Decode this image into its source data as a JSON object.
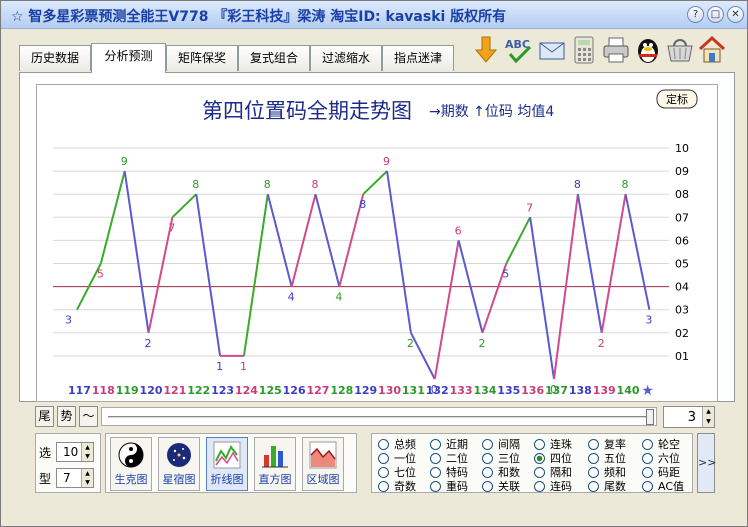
{
  "window": {
    "title": "☆ 智多星彩票预测全能王V778 『彩王科技』梁涛 淘宝ID: kavaski 版权所有"
  },
  "tabs": [
    {
      "label": "历史数据",
      "active": false
    },
    {
      "label": "分析预测",
      "active": true
    },
    {
      "label": "矩阵保奖",
      "active": false
    },
    {
      "label": "复式组合",
      "active": false
    },
    {
      "label": "过滤缩水",
      "active": false
    },
    {
      "label": "指点迷津",
      "active": false
    }
  ],
  "toolbar": {
    "icons": [
      "download-arrow-icon",
      "spellcheck-abc-icon",
      "envelope-icon",
      "calculator-icon",
      "printer-icon",
      "qq-penguin-icon",
      "shopping-basket-icon",
      "home-icon"
    ]
  },
  "chart_data": {
    "type": "line",
    "title": "第四位置码全期走势图",
    "legend_text": "→期数 ↑位码 均值4",
    "corner_button": "定标",
    "x": [
      117,
      118,
      119,
      120,
      121,
      122,
      123,
      124,
      125,
      126,
      127,
      128,
      129,
      130,
      131,
      132,
      133,
      134,
      135,
      136,
      137,
      138,
      139,
      140
    ],
    "values": [
      3,
      5,
      9,
      2,
      7,
      8,
      1,
      1,
      8,
      4,
      8,
      4,
      8,
      9,
      2,
      0,
      6,
      2,
      5,
      7,
      0,
      8,
      2,
      8,
      3
    ],
    "y_ticks": [
      "01",
      "02",
      "03",
      "04",
      "05",
      "06",
      "07",
      "08",
      "09",
      "10"
    ],
    "ylim": [
      0,
      10
    ],
    "average_line": 4,
    "segment_colors": {
      "up_after_down": "#d24a8a",
      "up": "#3aaa2a",
      "down": "#5a5ad2"
    },
    "x_label_colors": [
      "#3c3cc8",
      "#c83c78",
      "#2a9a2a",
      "#3c3cc8",
      "#c83c78",
      "#2a9a2a",
      "#3c3cc8",
      "#c83c78",
      "#2a9a2a",
      "#3c3cc8",
      "#c83c78",
      "#2a9a2a",
      "#3c3cc8",
      "#c83c78",
      "#2a9a2a",
      "#3c3cc8",
      "#c83c78",
      "#2a9a2a",
      "#3c3cc8",
      "#c83c78",
      "#2a9a2a",
      "#3c3cc8",
      "#c83c78",
      "#2a9a2a"
    ],
    "star_marker": "★"
  },
  "slider": {
    "btn1": "尾",
    "btn2": "势",
    "btn3": "〜",
    "value": "3"
  },
  "controls": {
    "select_label": "选",
    "select_value": "10",
    "type_label": "型",
    "type_value": "7",
    "views": [
      {
        "label": "生克图",
        "icon": "yin-yang-icon",
        "active": false
      },
      {
        "label": "星宿图",
        "icon": "star-globe-icon",
        "active": false
      },
      {
        "label": "折线图",
        "icon": "line-chart-icon",
        "active": true
      },
      {
        "label": "直方图",
        "icon": "bar-chart-icon",
        "active": false
      },
      {
        "label": "区域图",
        "icon": "area-chart-icon",
        "active": false
      }
    ]
  },
  "options": {
    "columns": [
      [
        "总频",
        "一位",
        "七位",
        "奇数"
      ],
      [
        "近期",
        "二位",
        "特码",
        "重码"
      ],
      [
        "间隔",
        "三位",
        "和数",
        "关联"
      ],
      [
        "连珠",
        "四位",
        "隔和",
        "连码"
      ],
      [
        "复率",
        "五位",
        "频和",
        "尾数"
      ],
      [
        "轮空",
        "六位",
        "码距",
        "AC值"
      ]
    ],
    "selected": "四位",
    "more_label": ">>"
  }
}
